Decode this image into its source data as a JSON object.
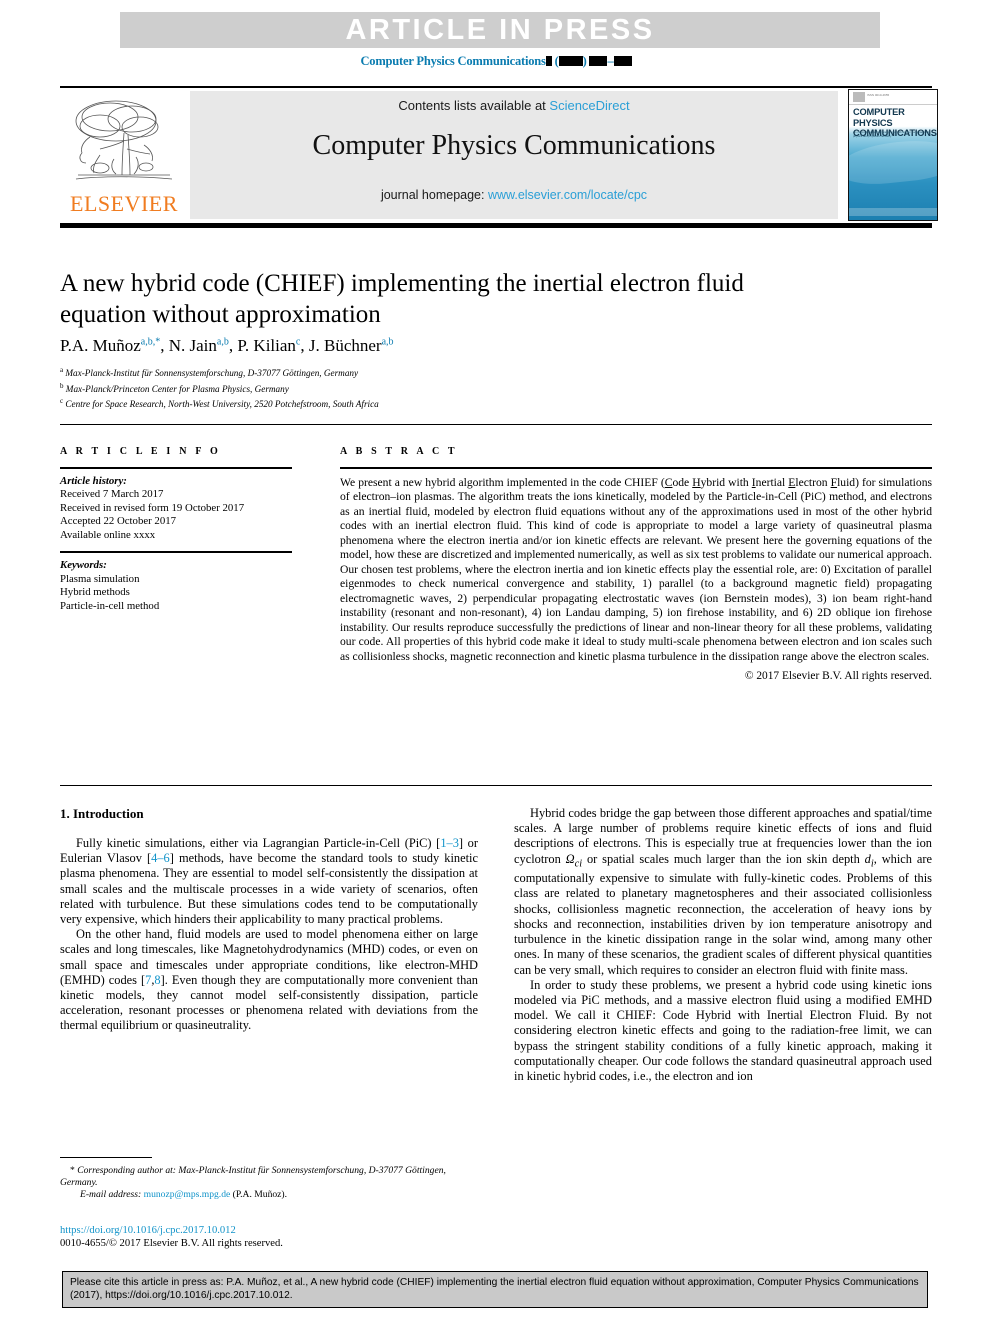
{
  "banner": {
    "text": "ARTICLE IN PRESS"
  },
  "running_head": {
    "journal": "Computer Physics Communications",
    "volume_placeholder": "▮",
    "year_placeholder": "▮▮▮▮",
    "pages_placeholder": "▮▮▮–▮▮▮"
  },
  "masthead": {
    "contents_prefix": "Contents lists available at ",
    "sciencedirect": "ScienceDirect",
    "journal_title": "Computer Physics Communications",
    "homepage_prefix": "journal homepage: ",
    "homepage_url": "www.elsevier.com/locate/cpc",
    "publisher": "ELSEVIER",
    "cover_title": "COMPUTER PHYSICS COMMUNICATIONS",
    "cover_subtitle": "An international journal and program library for computational physics and physical chemistry",
    "colors": {
      "link": "#2a9fd6",
      "elsevier_orange": "#f07c20",
      "banner_grey": "#cecece"
    }
  },
  "article": {
    "title": "A new hybrid code (CHIEF) implementing the inertial electron fluid equation without approximation",
    "authors": [
      {
        "name": "P.A. Muñoz",
        "marks": "a,b,*"
      },
      {
        "name": "N. Jain",
        "marks": "a,b"
      },
      {
        "name": "P. Kilian",
        "marks": "c"
      },
      {
        "name": "J. Büchner",
        "marks": "a,b"
      }
    ],
    "affiliations": [
      {
        "mark": "a",
        "text": "Max-Planck-Institut für Sonnensystemforschung, D-37077 Göttingen, Germany"
      },
      {
        "mark": "b",
        "text": "Max-Planck/Princeton Center for Plasma Physics, Germany"
      },
      {
        "mark": "c",
        "text": "Centre for Space Research, North-West University, 2520 Potchefstroom, South Africa"
      }
    ]
  },
  "article_info": {
    "heading": "A R T I C L E   I N F O",
    "history_label": "Article history:",
    "history": [
      "Received 7 March 2017",
      "Received in revised form 19 October 2017",
      "Accepted 22 October 2017",
      "Available online xxxx"
    ],
    "keywords_label": "Keywords:",
    "keywords": [
      "Plasma simulation",
      "Hybrid methods",
      "Particle-in-cell method"
    ]
  },
  "abstract": {
    "heading": "A B S T R A C T",
    "paragraph_1": "We present a new hybrid algorithm implemented in the code CHIEF (",
    "acronym_c": "C",
    "acronym_rest1": "ode ",
    "acronym_h": "H",
    "acronym_rest2": "ybrid with ",
    "acronym_i": "I",
    "acronym_rest3": "nertial ",
    "acronym_e": "E",
    "acronym_rest4": "lectron ",
    "acronym_f": "F",
    "acronym_rest5": "luid)",
    "paragraph_2": " for simulations of electron–ion plasmas. The algorithm treats the ions kinetically, modeled by the Particle-in-Cell (PiC) method, and electrons as an inertial fluid, modeled by electron fluid equations without any of the approximations used in most of the other hybrid codes with an inertial electron fluid. This kind of code is appropriate to model a large variety of quasineutral plasma phenomena where the electron inertia and/or ion kinetic effects are relevant. We present here the governing equations of the model, how these are discretized and implemented numerically, as well as six test problems to validate our numerical approach. Our chosen test problems, where the electron inertia and ion kinetic effects play the essential role, are: 0) Excitation of parallel eigenmodes to check numerical convergence and stability, 1) parallel (to a background magnetic field) propagating electromagnetic waves, 2) perpendicular propagating electrostatic waves (ion Bernstein modes), 3) ion beam right-hand instability (resonant and non-resonant), 4) ion Landau damping, 5) ion firehose instability, and 6) 2D oblique ion firehose instability. Our results reproduce successfully the predictions of linear and non-linear theory for all these problems, validating our code. All properties of this hybrid code make it ideal to study multi-scale phenomena between electron and ion scales such as collisionless shocks, magnetic reconnection and kinetic plasma turbulence in the dissipation range above the electron scales.",
    "copyright": "© 2017 Elsevier B.V. All rights reserved."
  },
  "introduction": {
    "heading": "1. Introduction",
    "left_paragraphs": [
      {
        "parts": [
          {
            "t": "Fully kinetic simulations, either via Lagrangian Particle-in-Cell (PiC) ["
          },
          {
            "t": "1–3",
            "ref": true
          },
          {
            "t": "] or Eulerian Vlasov ["
          },
          {
            "t": "4–6",
            "ref": true
          },
          {
            "t": "] methods, have become the standard tools to study kinetic plasma phenomena. They are essential to model self-consistently the dissipation at small scales and the multiscale processes in a wide variety of scenarios, often related with turbulence. But these simulations codes tend to be computationally very expensive, which hinders their applicability to many practical problems."
          }
        ]
      },
      {
        "parts": [
          {
            "t": "On the other hand, fluid models are used to model phenomena either on large scales and long timescales, like Magnetohydrodynamics (MHD) codes, or even on small space and timescales under appropriate conditions, like electron-MHD (EMHD) codes ["
          },
          {
            "t": "7",
            "ref": true
          },
          {
            "t": ","
          },
          {
            "t": "8",
            "ref": true
          },
          {
            "t": "]. Even though they are computationally more convenient than kinetic models, they cannot model self-consistently dissipation, particle acceleration, resonant processes or phenomena related with deviations from the thermal equilibrium or quasineutrality."
          }
        ]
      }
    ],
    "right_paragraphs": [
      "Hybrid codes bridge the gap between those different approaches and spatial/time scales. A large number of problems require kinetic effects of ions and fluid descriptions of electrons. This is especially true at frequencies lower than the ion cyclotron Ωci or spatial scales much larger than the ion skin depth di, which are computationally expensive to simulate with fully-kinetic codes. Problems of this class are related to planetary magnetospheres and their associated collisionless shocks, collisionless magnetic reconnection, the acceleration of heavy ions by shocks and reconnection, instabilities driven by ion temperature anisotropy and turbulence in the kinetic dissipation range in the solar wind, among many other ones. In many of these scenarios, the gradient scales of different physical quantities can be very small, which requires to consider an electron fluid with finite mass.",
      "In order to study these problems, we present a hybrid code using kinetic ions modeled via PiC methods, and a massive electron fluid using a modified EMHD model. We call it CHIEF: Code Hybrid with Inertial Electron Fluid. By not considering electron kinetic effects and going to the radiation-free limit, we can bypass the stringent stability conditions of a fully kinetic approach, making it computationally cheaper. Our code follows the standard quasineutral approach used in kinetic hybrid codes, i.e., the electron and ion"
    ]
  },
  "footnote": {
    "star": "*",
    "corresponding": " Corresponding author at: Max-Planck-Institut für Sonnensystemforschung, D-37077 Göttingen, Germany.",
    "email_label": "E-mail address:",
    "email": "munozp@mps.mpg.de",
    "email_suffix": " (P.A. Muñoz)."
  },
  "doi_block": {
    "doi": "https://doi.org/10.1016/j.cpc.2017.10.012",
    "issn_line": "0010-4655/© 2017 Elsevier B.V. All rights reserved."
  },
  "cite_box": {
    "text": "Please cite this article in press as: P.A. Muñoz, et al., A new hybrid code (CHIEF) implementing the inertial electron fluid equation without approximation, Computer Physics Communications (2017), https://doi.org/10.1016/j.cpc.2017.10.012."
  }
}
